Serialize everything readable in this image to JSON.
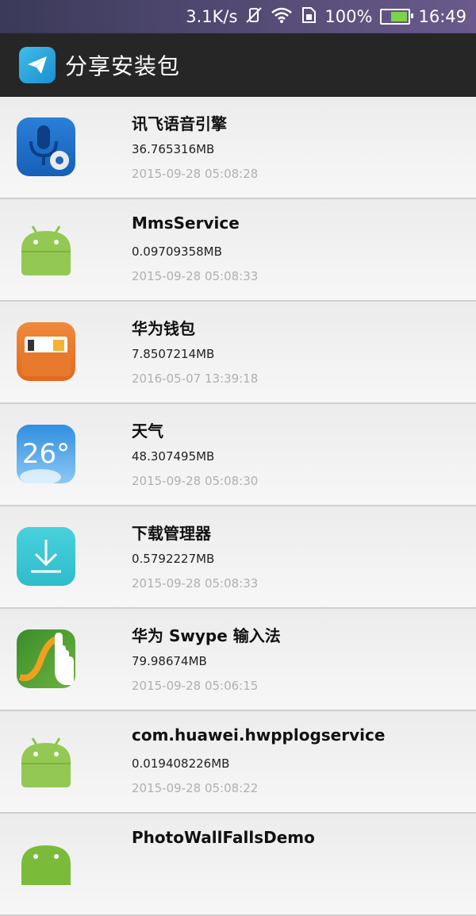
{
  "status": {
    "speed": "3.1K/s",
    "battery": "100%",
    "time": "16:49"
  },
  "appbar": {
    "title": "分享安装包"
  },
  "apps": [
    {
      "name": "讯飞语音引擎",
      "size": "36.765316MB",
      "date": "2015-09-28 05:08:28",
      "icon": "mic-gear-icon"
    },
    {
      "name": "MmsService",
      "size": "0.09709358MB",
      "date": "2015-09-28 05:08:33",
      "icon": "android-icon"
    },
    {
      "name": "华为钱包",
      "size": "7.8507214MB",
      "date": "2016-05-07 13:39:18",
      "icon": "wallet-icon"
    },
    {
      "name": "天气",
      "size": "48.307495MB",
      "date": "2015-09-28 05:08:30",
      "icon": "weather-icon",
      "icon_text": "26°"
    },
    {
      "name": "下载管理器",
      "size": "0.5792227MB",
      "date": "2015-09-28 05:08:33",
      "icon": "download-icon"
    },
    {
      "name": "华为 Swype 输入法",
      "size": "79.98674MB",
      "date": "2015-09-28 05:06:15",
      "icon": "swype-icon"
    },
    {
      "name": "com.huawei.hwpplogservice",
      "size": "0.019408226MB",
      "date": "2015-09-28 05:08:22",
      "icon": "android-icon"
    },
    {
      "name": "PhotoWallFallsDemo",
      "size": "",
      "date": "",
      "icon": "android-icon"
    }
  ]
}
